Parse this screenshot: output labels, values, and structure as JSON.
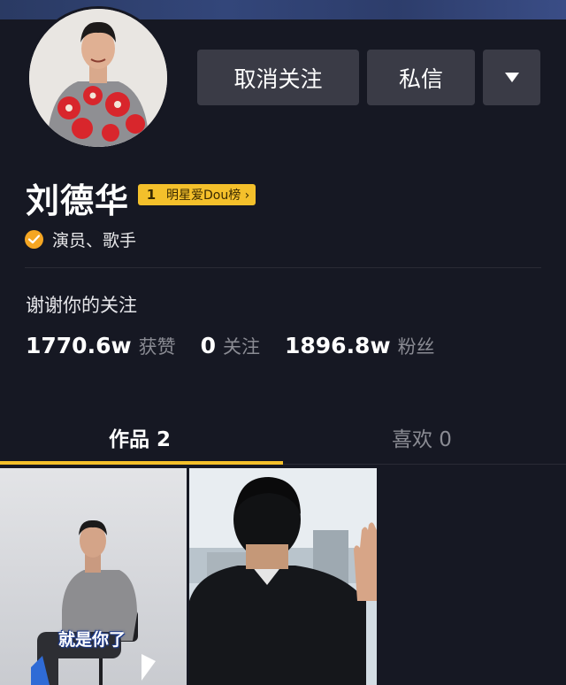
{
  "profile": {
    "name": "刘德华",
    "badge_rank": "1",
    "badge_text": "明星爱Dou榜 ›",
    "verification": "演员、歌手",
    "bio": "谢谢你的关注"
  },
  "actions": {
    "unfollow_label": "取消关注",
    "message_label": "私信",
    "more_icon": "caret-down-icon"
  },
  "stats": [
    {
      "value": "1770.6w",
      "label": "获赞"
    },
    {
      "value": "0",
      "label": "关注"
    },
    {
      "value": "1896.8w",
      "label": "粉丝"
    }
  ],
  "tabs": [
    {
      "label": "作品 2",
      "active": true
    },
    {
      "label": "喜欢 0",
      "active": false
    }
  ],
  "videos": [
    {
      "caption": "就是你了"
    },
    {
      "caption": ""
    }
  ],
  "colors": {
    "background": "#161823",
    "accent": "#f4c02b",
    "button": "#3a3b46",
    "verify": "#f5a623"
  }
}
